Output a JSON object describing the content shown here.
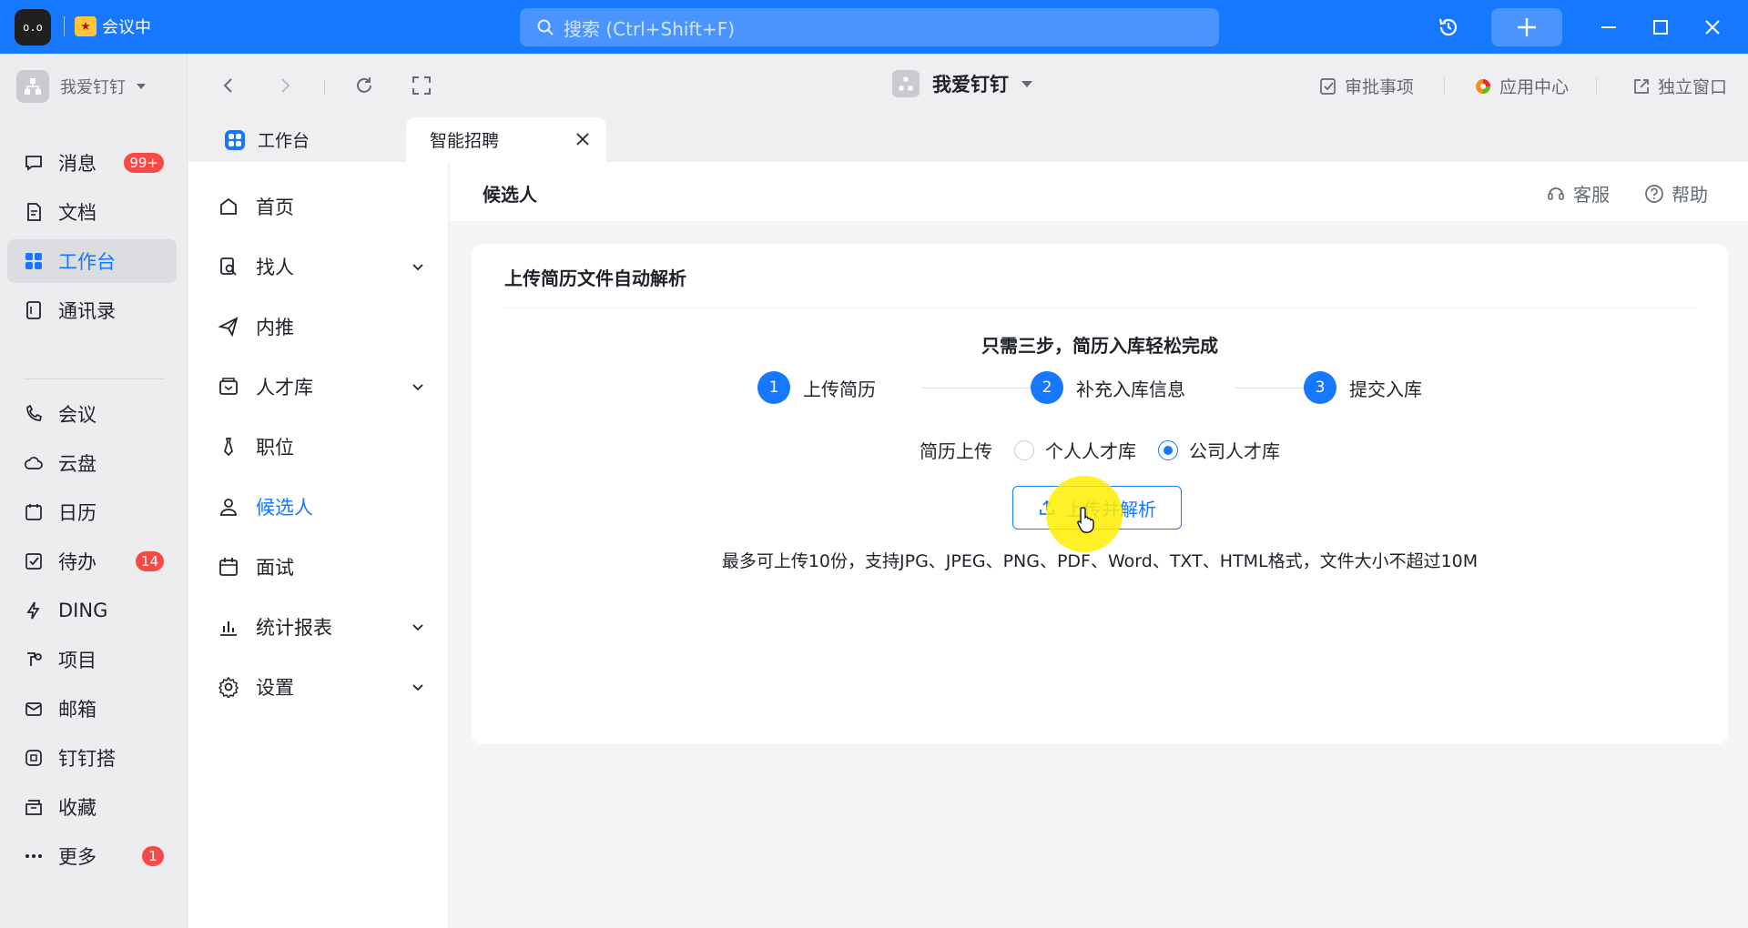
{
  "titlebar": {
    "app_logo_text": "o.o",
    "meeting_label": "会议中",
    "search_placeholder": "搜索 (Ctrl+Shift+F)"
  },
  "leftnav": {
    "org_name": "我爱钉钉",
    "items": [
      {
        "label": "消息",
        "icon": "message-icon",
        "badge": "99+"
      },
      {
        "label": "文档",
        "icon": "document-icon",
        "badge": ""
      },
      {
        "label": "工作台",
        "icon": "workbench-icon",
        "badge": "",
        "active": true
      },
      {
        "label": "通讯录",
        "icon": "contacts-icon",
        "badge": ""
      },
      {
        "label": "会议",
        "icon": "phone-icon",
        "badge": ""
      },
      {
        "label": "云盘",
        "icon": "cloud-icon",
        "badge": ""
      },
      {
        "label": "日历",
        "icon": "calendar-icon",
        "badge": ""
      },
      {
        "label": "待办",
        "icon": "todo-icon",
        "badge": "14"
      },
      {
        "label": "DING",
        "icon": "lightning-icon",
        "badge": ""
      },
      {
        "label": "项目",
        "icon": "project-icon",
        "badge": ""
      },
      {
        "label": "邮箱",
        "icon": "mail-icon",
        "badge": ""
      },
      {
        "label": "钉钉搭",
        "icon": "builder-icon",
        "badge": ""
      },
      {
        "label": "收藏",
        "icon": "favorites-icon",
        "badge": ""
      },
      {
        "label": "更多",
        "icon": "more-icon",
        "badge": "1"
      }
    ]
  },
  "toolbar": {
    "center_title": "我爱钉钉",
    "approval": "审批事项",
    "app_center": "应用中心",
    "standalone": "独立窗口"
  },
  "tabs": {
    "workbench": "工作台",
    "recruit": "智能招聘"
  },
  "appside": {
    "items": [
      {
        "label": "首页",
        "icon": "home-icon",
        "chevron": false
      },
      {
        "label": "找人",
        "icon": "find-person-icon",
        "chevron": true
      },
      {
        "label": "内推",
        "icon": "send-icon",
        "chevron": false
      },
      {
        "label": "人才库",
        "icon": "talent-pool-icon",
        "chevron": true
      },
      {
        "label": "职位",
        "icon": "tie-icon",
        "chevron": false
      },
      {
        "label": "候选人",
        "icon": "user-icon",
        "chevron": false,
        "active": true
      },
      {
        "label": "面试",
        "icon": "calendar-icon",
        "chevron": false
      },
      {
        "label": "统计报表",
        "icon": "bar-chart-icon",
        "chevron": true
      },
      {
        "label": "设置",
        "icon": "settings-icon",
        "chevron": true
      }
    ]
  },
  "content": {
    "title": "候选人",
    "service": "客服",
    "help": "帮助",
    "card_title": "上传简历文件自动解析",
    "steps_heading": "只需三步，简历入库轻松完成",
    "steps": [
      {
        "num": "1",
        "label": "上传简历"
      },
      {
        "num": "2",
        "label": "补充入库信息"
      },
      {
        "num": "3",
        "label": "提交入库"
      }
    ],
    "upload_label": "简历上传",
    "radio_personal": "个人人才库",
    "radio_company": "公司人才库",
    "selected_radio": "公司人才库",
    "upload_button": "上传并解析",
    "hint": "最多可上传10份，支持JPG、JPEG、PNG、PDF、Word、TXT、HTML格式，文件大小不超过10M"
  },
  "colors": {
    "accent": "#1677ff",
    "badge": "#f54a45",
    "cursor_highlight": "#ffee00"
  }
}
